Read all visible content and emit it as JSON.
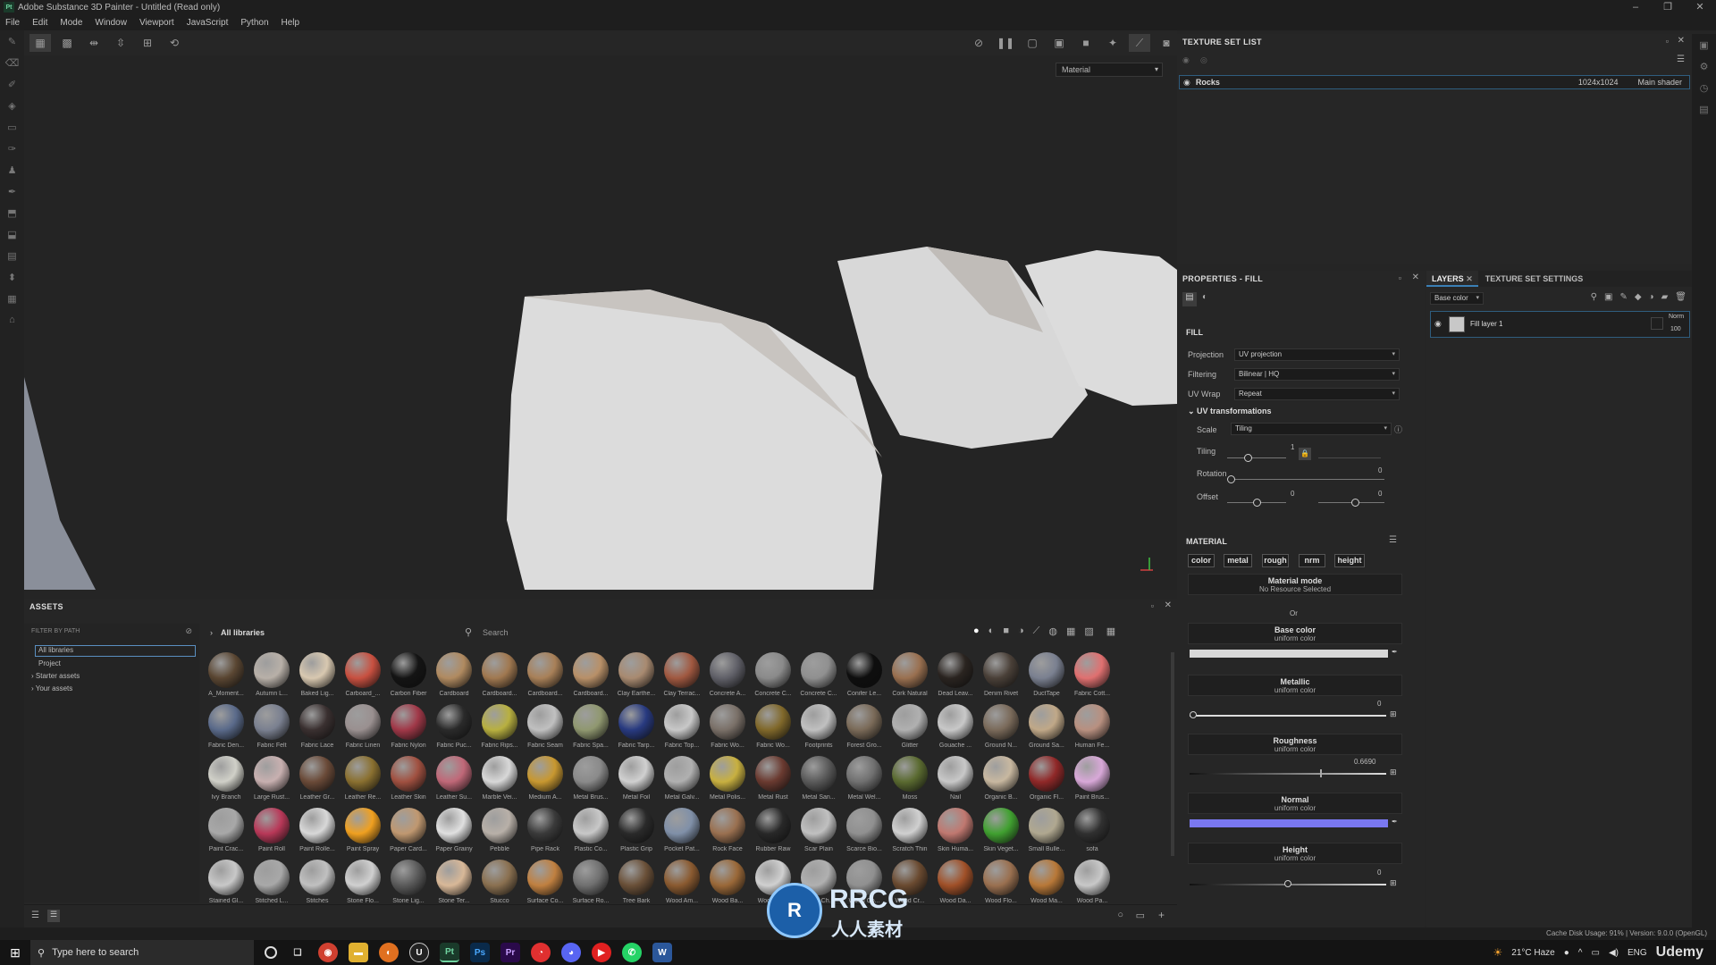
{
  "app": {
    "title": "Adobe Substance 3D Painter - Untitled (Read only)",
    "logo": "Pt"
  },
  "menu": [
    "File",
    "Edit",
    "Mode",
    "Window",
    "Viewport",
    "JavaScript",
    "Python",
    "Help"
  ],
  "viewport": {
    "mode_select": "Material"
  },
  "texture_set_list": {
    "title": "TEXTURE SET LIST",
    "row": {
      "name": "Rocks",
      "size": "1024x1024",
      "shader": "Main shader"
    }
  },
  "properties": {
    "title": "PROPERTIES - FILL",
    "fill_title": "FILL",
    "projection": {
      "label": "Projection",
      "value": "UV projection"
    },
    "filtering": {
      "label": "Filtering",
      "value": "Bilinear | HQ"
    },
    "uvwrap": {
      "label": "UV Wrap",
      "value": "Repeat"
    },
    "uvtrans": {
      "title": "UV transformations"
    },
    "scale": {
      "label": "Scale",
      "value": "Tiling"
    },
    "tiling": {
      "label": "Tiling",
      "value": "1",
      "fraction": 0.35
    },
    "rotation": {
      "label": "Rotation",
      "value": "0",
      "fraction": 0.0
    },
    "offset": {
      "label": "Offset",
      "value1": "0",
      "value2": "0"
    },
    "material_title": "MATERIAL",
    "channels": [
      "color",
      "metal",
      "rough",
      "nrm",
      "height"
    ],
    "material_mode": {
      "title": "Material mode",
      "sub": "No Resource Selected"
    },
    "or": "Or",
    "base_color": {
      "title": "Base color",
      "sub": "uniform color",
      "swatch": "#d8d8d8"
    },
    "metallic": {
      "title": "Metallic",
      "sub": "uniform color",
      "value": "0",
      "fraction": 0.0
    },
    "roughness": {
      "title": "Roughness",
      "sub": "uniform color",
      "value": "0.6690",
      "fraction": 0.669
    },
    "normal": {
      "title": "Normal",
      "sub": "uniform color",
      "swatch": "#7a78f0"
    },
    "height": {
      "title": "Height",
      "sub": "uniform color",
      "value": "0",
      "fraction": 0.5
    }
  },
  "layers": {
    "tab_layers": "LAYERS",
    "tab_tss": "TEXTURE SET SETTINGS",
    "channel_select": "Base color",
    "layer": {
      "name": "Fill layer 1",
      "blend": "Norm",
      "opacity": "100"
    }
  },
  "assets": {
    "title": "ASSETS",
    "filter": "FILTER BY PATH",
    "tree": [
      "All libraries",
      "Project",
      "Starter assets",
      "Your assets"
    ],
    "path": "All libraries",
    "search_placeholder": "Search",
    "materials": [
      {
        "name": "A_Moment...",
        "color": "#5a4632"
      },
      {
        "name": "Autumn L...",
        "color": "#b8b0a8"
      },
      {
        "name": "Baked Lig...",
        "color": "#d8c8b0"
      },
      {
        "name": "Carboard_...",
        "color": "#c85040"
      },
      {
        "name": "Carbon Fiber",
        "color": "#141414"
      },
      {
        "name": "Cardboard",
        "color": "#b08a60"
      },
      {
        "name": "Cardboard...",
        "color": "#a07850"
      },
      {
        "name": "Cardboard...",
        "color": "#a88058"
      },
      {
        "name": "Cardboard...",
        "color": "#b89068"
      },
      {
        "name": "Clay Earthe...",
        "color": "#a88a70"
      },
      {
        "name": "Clay Terrac...",
        "color": "#a05840"
      },
      {
        "name": "Concrete A...",
        "color": "#606068"
      },
      {
        "name": "Concrete C...",
        "color": "#8a8a8a"
      },
      {
        "name": "Concrete C...",
        "color": "#909090"
      },
      {
        "name": "Conifer Le...",
        "color": "#0e0e0e"
      },
      {
        "name": "Cork Natural",
        "color": "#9a7050"
      },
      {
        "name": "Dead Leav...",
        "color": "#2a2420"
      },
      {
        "name": "Denim Rivet",
        "color": "#4a4038"
      },
      {
        "name": "DuctTape",
        "color": "#7a8090"
      },
      {
        "name": "Fabric Cott...",
        "color": "#e07070"
      },
      {
        "name": "Fabric Den...",
        "color": "#5a6a8a"
      },
      {
        "name": "Fabric Felt",
        "color": "#7a8090"
      },
      {
        "name": "Fabric Lace",
        "color": "#3a3030"
      },
      {
        "name": "Fabric Linen",
        "color": "#9a9090"
      },
      {
        "name": "Fabric Nylon",
        "color": "#a03848"
      },
      {
        "name": "Fabric Puc...",
        "color": "#2a2a2a"
      },
      {
        "name": "Fabric Rips...",
        "color": "#b8b040"
      },
      {
        "name": "Fabric Seam",
        "color": "#c0c0c0"
      },
      {
        "name": "Fabric Spa...",
        "color": "#909870"
      },
      {
        "name": "Fabric Tarp...",
        "color": "#283a80"
      },
      {
        "name": "Fabric Top...",
        "color": "#c8c8c8"
      },
      {
        "name": "Fabric Wo...",
        "color": "#7a7068"
      },
      {
        "name": "Fabric Wo...",
        "color": "#80682a"
      },
      {
        "name": "Footprints",
        "color": "#c0c0c0"
      },
      {
        "name": "Forest Gro...",
        "color": "#7a6a58"
      },
      {
        "name": "Glitter",
        "color": "#b0b0b0"
      },
      {
        "name": "Gouache ...",
        "color": "#c8c8c8"
      },
      {
        "name": "Ground N...",
        "color": "#7a6a5a"
      },
      {
        "name": "Ground Sa...",
        "color": "#c0a888"
      },
      {
        "name": "Human Fe...",
        "color": "#b89080"
      },
      {
        "name": "Ivy Branch",
        "color": "#d0d0c8"
      },
      {
        "name": "Large Rust...",
        "color": "#c8b0b0"
      },
      {
        "name": "Leather Gr...",
        "color": "#6a4a38"
      },
      {
        "name": "Leather Re...",
        "color": "#8a7030"
      },
      {
        "name": "Leather Skin",
        "color": "#a05040"
      },
      {
        "name": "Leather Su...",
        "color": "#c06878"
      },
      {
        "name": "Marble Vei...",
        "color": "#d8d8d8"
      },
      {
        "name": "Medium A...",
        "color": "#c89830"
      },
      {
        "name": "Metal Brus...",
        "color": "#8a8a8a"
      },
      {
        "name": "Metal Foil",
        "color": "#d0d0d0"
      },
      {
        "name": "Metal Galv...",
        "color": "#b0b0b0"
      },
      {
        "name": "Metal Polis...",
        "color": "#c8b040"
      },
      {
        "name": "Metal Rust",
        "color": "#6a3a30"
      },
      {
        "name": "Metal San...",
        "color": "#5a5a5a"
      },
      {
        "name": "Metal Wel...",
        "color": "#707070"
      },
      {
        "name": "Moss",
        "color": "#5a6a30"
      },
      {
        "name": "Nail",
        "color": "#c8c8c8"
      },
      {
        "name": "Organic B...",
        "color": "#c8b8a0"
      },
      {
        "name": "Organic Fl...",
        "color": "#902828"
      },
      {
        "name": "Paint Brus...",
        "color": "#d8a8d8"
      },
      {
        "name": "Paint Crac...",
        "color": "#a8a8a8"
      },
      {
        "name": "Paint Roll",
        "color": "#b83858"
      },
      {
        "name": "Paint Rolle...",
        "color": "#d8d8d8"
      },
      {
        "name": "Paint Spray",
        "color": "#f0a020"
      },
      {
        "name": "Paper Card...",
        "color": "#c09870"
      },
      {
        "name": "Paper Grainy",
        "color": "#e0e0e0"
      },
      {
        "name": "Pebble",
        "color": "#b8b0a8"
      },
      {
        "name": "Pipe Rack",
        "color": "#3a3a3a"
      },
      {
        "name": "Plastic Co...",
        "color": "#c8c8c8"
      },
      {
        "name": "Plastic Grip",
        "color": "#2a2a2a"
      },
      {
        "name": "Pocket Pat...",
        "color": "#8090a8"
      },
      {
        "name": "Rock Face",
        "color": "#9a7050"
      },
      {
        "name": "Rubber Raw",
        "color": "#282828"
      },
      {
        "name": "Scar Plain",
        "color": "#c0c0c0"
      },
      {
        "name": "Scarce Bio...",
        "color": "#909090"
      },
      {
        "name": "Scratch Thin",
        "color": "#d0d0d0"
      },
      {
        "name": "Skin Huma...",
        "color": "#c07870"
      },
      {
        "name": "Skin Veget...",
        "color": "#40a030"
      },
      {
        "name": "Small Bulle...",
        "color": "#b0a890"
      },
      {
        "name": "sofa",
        "color": "#303030"
      },
      {
        "name": "Stained Gl...",
        "color": "#c8c8c8"
      },
      {
        "name": "Stitched L...",
        "color": "#a8a8a8"
      },
      {
        "name": "Stitches",
        "color": "#c0c0c0"
      },
      {
        "name": "Stone Flo...",
        "color": "#d0d0d0"
      },
      {
        "name": "Stone Lig...",
        "color": "#5a5a5a"
      },
      {
        "name": "Stone Ter...",
        "color": "#d8b898"
      },
      {
        "name": "Stucco",
        "color": "#8a7050"
      },
      {
        "name": "Surface Co...",
        "color": "#c08040"
      },
      {
        "name": "Surface Ro...",
        "color": "#707070"
      },
      {
        "name": "Tree Bark",
        "color": "#6a5038"
      },
      {
        "name": "Wood Am...",
        "color": "#8a5a30"
      },
      {
        "name": "Wood Ba...",
        "color": "#9a6838"
      },
      {
        "name": "Wood Be...",
        "color": "#d0d0d0"
      },
      {
        "name": "Wood Ch...",
        "color": "#b0b0b0"
      },
      {
        "name": "Wood Co...",
        "color": "#909090"
      },
      {
        "name": "Wood Cr...",
        "color": "#6a4a30"
      },
      {
        "name": "Wood Da...",
        "color": "#a05028"
      },
      {
        "name": "Wood Flo...",
        "color": "#9a7050"
      },
      {
        "name": "Wood Ma...",
        "color": "#b87838"
      },
      {
        "name": "Wood Pa...",
        "color": "#c8c8c8"
      }
    ]
  },
  "status": "Cache Disk Usage:  91% | Version: 9.0.0 (OpenGL)",
  "taskbar": {
    "search": "Type here to search",
    "weather": "21°C  Haze",
    "lang": "ENG",
    "brand": "Udemy"
  },
  "watermark": {
    "text1": "RRCG",
    "text2": "人人素材"
  }
}
